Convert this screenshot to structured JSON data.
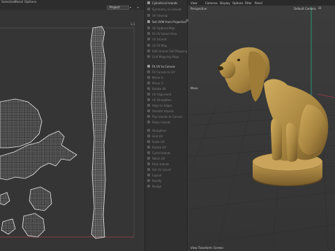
{
  "menubar": {
    "items": [
      "Selection",
      "Panel",
      "Options"
    ]
  },
  "uv_editor": {
    "view_select": "Project",
    "corner_label_top": "1,1"
  },
  "tools": {
    "items": [
      {
        "label": "Cylindrical Islands",
        "highlight": false
      },
      {
        "label": "Symmetry on Islands",
        "highlight": false
      },
      {
        "label": "UV Unwrap",
        "highlight": false
      },
      {
        "label": "Set UVW from Projection",
        "highlight": true
      },
      {
        "label": "UV Optimal Map",
        "highlight": false
      },
      {
        "label": "Fit UV Island Area",
        "highlight": false
      },
      {
        "label": "UV Islands",
        "highlight": false
      },
      {
        "label": "UV Fit Map",
        "highlight": false
      },
      {
        "label": "Edit Islands Self Mapping",
        "highlight": false
      },
      {
        "label": "Grid Mapping Align",
        "highlight": false
      },
      {
        "label": "Fit UV to Canvas",
        "highlight": true
      },
      {
        "label": "Fit Canvas to UV",
        "highlight": false
      },
      {
        "label": "Mirror U",
        "highlight": false
      },
      {
        "label": "Mirror V",
        "highlight": false
      },
      {
        "label": "Rotate 90",
        "highlight": false
      },
      {
        "label": "UV Alignment",
        "highlight": false
      },
      {
        "label": "UV Straighten",
        "highlight": false
      },
      {
        "label": "Align to Edges",
        "highlight": false
      },
      {
        "label": "Smooth Islands",
        "highlight": false
      },
      {
        "label": "Flip Islands to Canvas",
        "highlight": false
      },
      {
        "label": "Relax Islands",
        "highlight": false
      },
      {
        "label": "Straighten",
        "highlight": false
      },
      {
        "label": "Grid UV",
        "highlight": false
      },
      {
        "label": "Scale UV",
        "highlight": false
      },
      {
        "label": "Rotate UV",
        "highlight": false
      },
      {
        "label": "Cycle Islands",
        "highlight": false
      },
      {
        "label": "Stitch UV",
        "highlight": false
      },
      {
        "label": "Pack Islands",
        "highlight": false
      },
      {
        "label": "Set UV Island",
        "highlight": false
      },
      {
        "label": "Layout",
        "highlight": false
      },
      {
        "label": "Rectify",
        "highlight": false
      },
      {
        "label": "Nudge",
        "highlight": false
      }
    ]
  },
  "viewport": {
    "menu": [
      "View",
      "Cameras",
      "Display",
      "Options",
      "Filter",
      "Panel"
    ],
    "view_name": "Perspective",
    "camera": "Default Camera",
    "axis_label": "Move",
    "status": "View Transform: Screen"
  },
  "colors": {
    "uv_background": "#353535",
    "uv_lines": "#d9d9d9",
    "statue_gold": "#b8944a",
    "axis_green": "#1fd39a",
    "axis_red": "#d23a5a"
  }
}
